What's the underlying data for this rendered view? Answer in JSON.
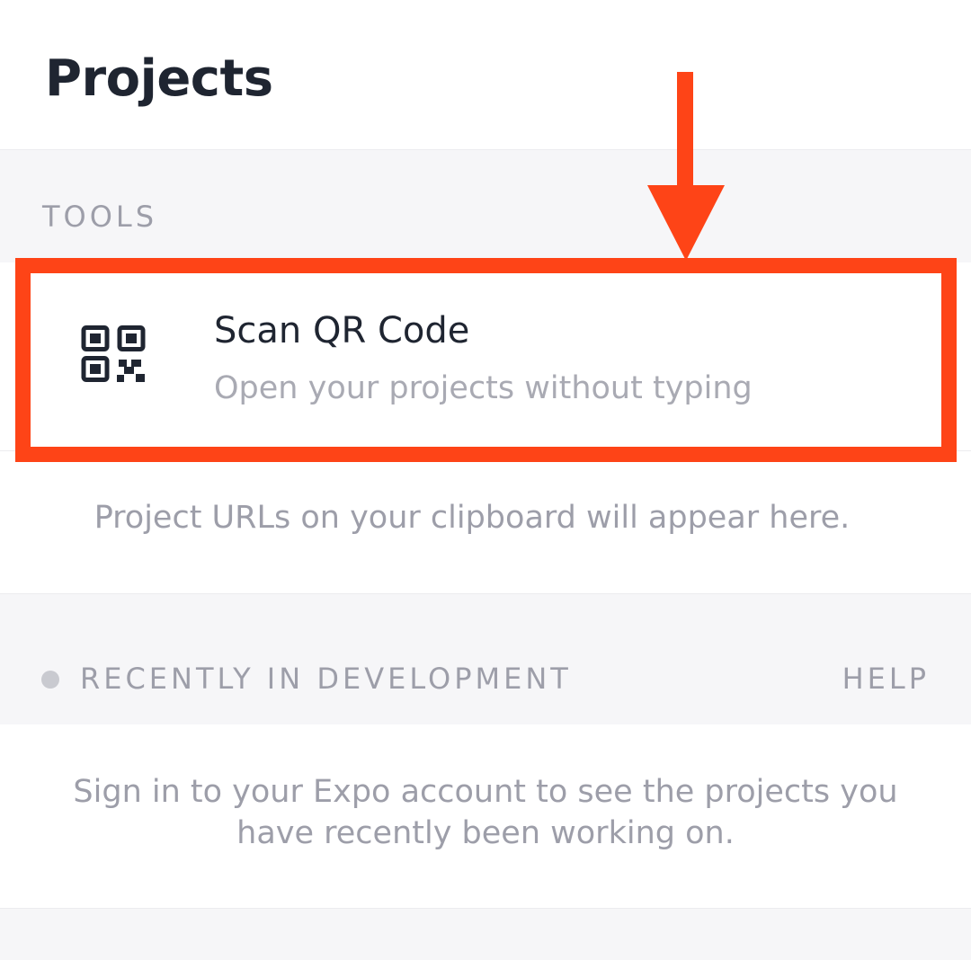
{
  "header": {
    "title": "Projects"
  },
  "tools": {
    "section_label": "TOOLS",
    "scan_qr": {
      "title": "Scan QR Code",
      "subtitle": "Open your projects without typing",
      "icon": "qr-code-icon"
    }
  },
  "clipboard": {
    "message": "Project URLs on your clipboard will appear here."
  },
  "recent": {
    "section_label": "RECENTLY IN DEVELOPMENT",
    "help_label": "HELP",
    "signin_message": "Sign in to your Expo account to see the projects you have recently been working on."
  },
  "annotation": {
    "color": "#fe4417",
    "arrow_icon": "down-arrow-icon"
  },
  "colors": {
    "title_text": "#1f2531",
    "muted_text": "#9d9ea9",
    "section_background": "#f6f6f8"
  }
}
